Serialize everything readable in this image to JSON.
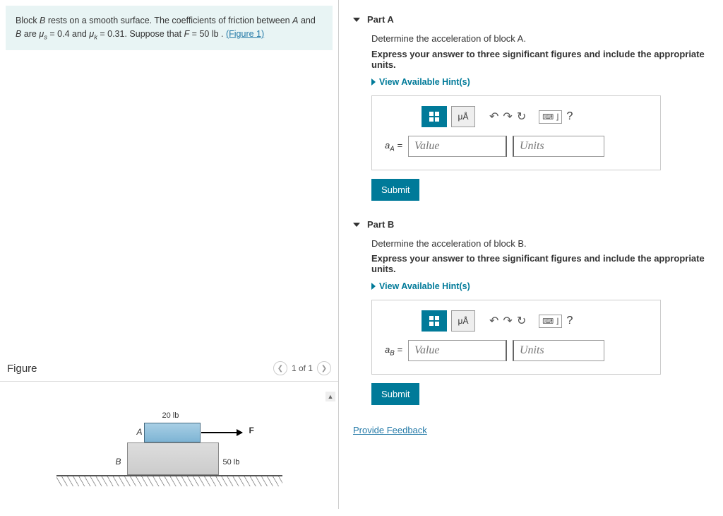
{
  "problem": {
    "text_pre": "Block ",
    "block_b": "B",
    "text_mid1": " rests on a smooth surface. The coefficients of friction between ",
    "block_a": "A",
    "text_and": " and ",
    "text_are": " are ",
    "mu_s_sym": "μ",
    "mu_s_sub": "s",
    "mu_s_val": " = 0.4 and ",
    "mu_k_sub": "k",
    "mu_k_val": " = 0.31. Suppose that ",
    "f_sym": "F",
    "f_val": " = 50 lb . ",
    "figure_link": "(Figure 1)"
  },
  "figure": {
    "title": "Figure",
    "pager": "1 of 1",
    "label_A": "A",
    "label_B": "B",
    "label_20": "20 lb",
    "label_50": "50 lb",
    "label_F": "F"
  },
  "toolbar": {
    "units": "μÅ",
    "keyboard": "⌨ ⌋",
    "help": "?"
  },
  "partA": {
    "title": "Part A",
    "instr": "Determine the acceleration of block A.",
    "instr_bold": "Express your answer to three significant figures and include the appropriate units.",
    "hints": "View Available Hint(s)",
    "var_label": "a",
    "var_sub": "A",
    "equals": " = ",
    "value_ph": "Value",
    "units_ph": "Units",
    "submit": "Submit"
  },
  "partB": {
    "title": "Part B",
    "instr": "Determine the acceleration of block B.",
    "instr_bold": "Express your answer to three significant figures and include the appropriate units.",
    "hints": "View Available Hint(s)",
    "var_label": "a",
    "var_sub": "B",
    "equals": " = ",
    "value_ph": "Value",
    "units_ph": "Units",
    "submit": "Submit"
  },
  "feedback": "Provide Feedback"
}
